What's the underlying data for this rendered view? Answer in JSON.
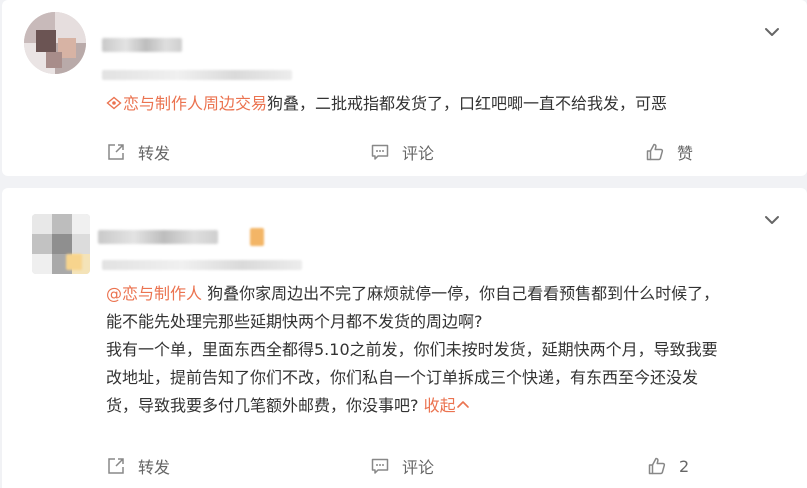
{
  "comments": [
    {
      "topic": "恋与制作人周边交易",
      "text": "狗叠，二批戒指都发货了，口红吧唧一直不给我发，可恶",
      "actions": {
        "repost": "转发",
        "comment": "评论",
        "like": "赞"
      }
    },
    {
      "mention": "@恋与制作人",
      "line1": " 狗叠你家周边出不完了麻烦就停一停，你自己看看预售都到什么时候了，",
      "line2": "能不能先处理完那些延期快两个月都不发货的周边啊?",
      "line3": "我有一个单，里面东西全都得5.10之前发，你们未按时发货，延期快两个月，导致我要",
      "line4": "改地址，提前告知了你们不改，你们私自一个订单拆成三个快递，有东西至今还没发",
      "line5": "货，导致我要多付几笔额外邮费，你没事吧?",
      "collapse": "收起",
      "actions": {
        "repost": "转发",
        "comment": "评论",
        "like_count": "2"
      }
    }
  ],
  "colors": {
    "accent": "#eb7350",
    "text": "#333333",
    "muted": "#666666",
    "bg": "#f1f2f5"
  },
  "icons": [
    "chevron-down-icon",
    "topic-icon",
    "repost-icon",
    "comment-icon",
    "like-icon",
    "chevron-up-icon"
  ]
}
